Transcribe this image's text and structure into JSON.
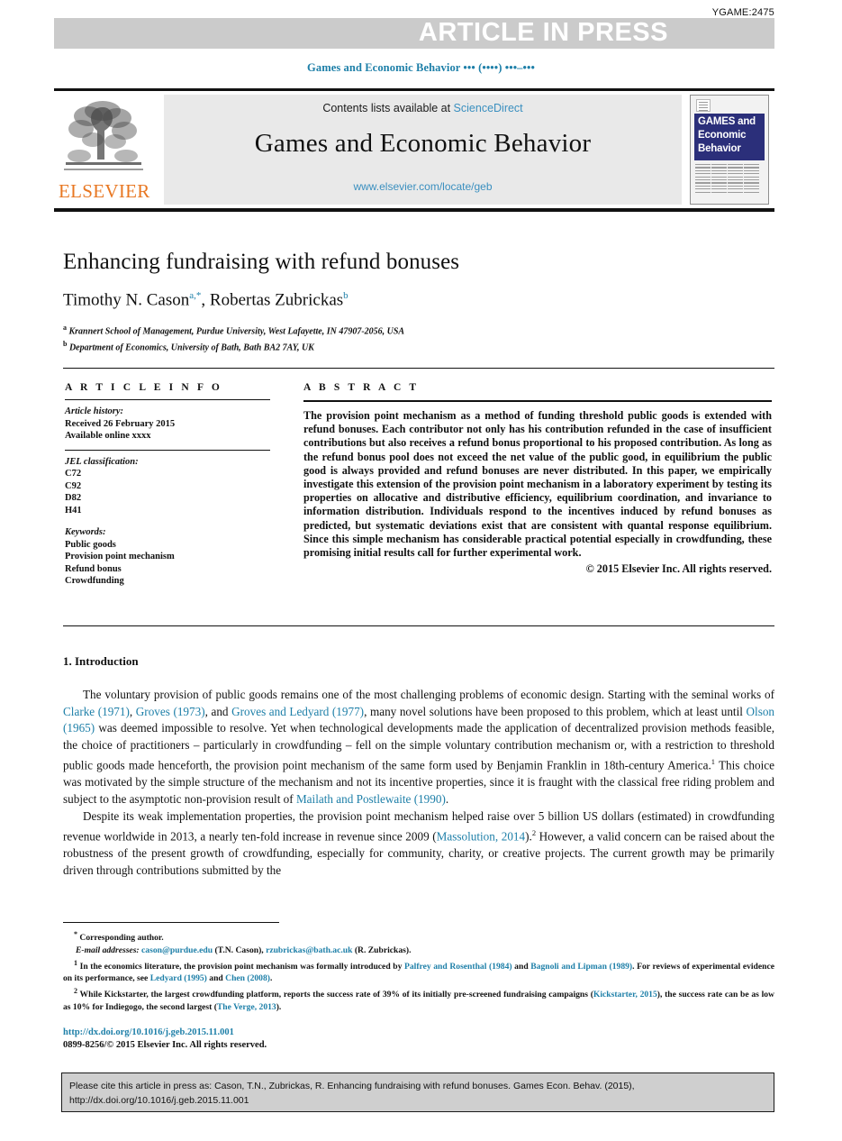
{
  "banner": {
    "press_label": "ARTICLE IN PRESS",
    "article_code": "YGAME:2475",
    "bar_color": "#cbcbcb"
  },
  "running_head": "Games and Economic Behavior ••• (••••) •••–•••",
  "masthead": {
    "publisher_name": "ELSEVIER",
    "contents_prefix": "Contents lists available at ",
    "contents_link": "ScienceDirect",
    "journal_title": "Games and Economic Behavior",
    "journal_url": "www.elsevier.com/locate/geb",
    "cover": {
      "line1": "GAMES and",
      "line2": "Economic",
      "line3": "Behavior",
      "cover_color": "#2b2f7a"
    }
  },
  "article": {
    "title": "Enhancing fundraising with refund bonuses",
    "authors": [
      {
        "name": "Timothy N. Cason",
        "marks": "a,*"
      },
      {
        "name": "Robertas Zubrickas",
        "marks": "b"
      }
    ],
    "affiliations": [
      {
        "mark": "a",
        "text": "Krannert School of Management, Purdue University, West Lafayette, IN 47907-2056, USA"
      },
      {
        "mark": "b",
        "text": "Department of Economics, University of Bath, Bath BA2 7AY, UK"
      }
    ]
  },
  "info": {
    "heading": "A R T I C L E    I N F O",
    "history_label": "Article history:",
    "history": [
      "Received 26 February 2015",
      "Available online xxxx"
    ],
    "jel_label": "JEL classification:",
    "jel_codes": [
      "C72",
      "C92",
      "D82",
      "H41"
    ],
    "keywords_label": "Keywords:",
    "keywords": [
      "Public goods",
      "Provision point mechanism",
      "Refund bonus",
      "Crowdfunding"
    ]
  },
  "abstract": {
    "heading": "A B S T R A C T",
    "text": "The provision point mechanism as a method of funding threshold public goods is extended with refund bonuses. Each contributor not only has his contribution refunded in the case of insufficient contributions but also receives a refund bonus proportional to his proposed contribution. As long as the refund bonus pool does not exceed the net value of the public good, in equilibrium the public good is always provided and refund bonuses are never distributed. In this paper, we empirically investigate this extension of the provision point mechanism in a laboratory experiment by testing its properties on allocative and distributive efficiency, equilibrium coordination, and invariance to information distribution. Individuals respond to the incentives induced by refund bonuses as predicted, but systematic deviations exist that are consistent with quantal response equilibrium. Since this simple mechanism has considerable practical potential especially in crowdfunding, these promising initial results call for further experimental work.",
    "copyright": "© 2015 Elsevier Inc. All rights reserved."
  },
  "section": {
    "number_title": "1. Introduction"
  },
  "body": {
    "p1_a": "The voluntary provision of public goods remains one of the most challenging problems of economic design. Starting with the seminal works of ",
    "p1_ref1": "Clarke (1971)",
    "p1_b": ", ",
    "p1_ref2": "Groves (1973)",
    "p1_c": ", and ",
    "p1_ref3": "Groves and Ledyard (1977)",
    "p1_d": ", many novel solutions have been proposed to this problem, which at least until ",
    "p1_ref4": "Olson (1965)",
    "p1_e": " was deemed impossible to resolve. Yet when technological developments made the application of decentralized provision methods feasible, the choice of practitioners – particularly in crowdfunding – fell on the simple voluntary contribution mechanism or, with a restriction to threshold public goods made henceforth, the provision point mechanism of the same form used by Benjamin Franklin in 18th-century America.",
    "p1_f": " This choice was motivated by the simple structure of the mechanism and not its incentive properties, since it is fraught with the classical free riding problem and subject to the asymptotic non-provision result of ",
    "p1_ref5": "Mailath and Postlewaite (1990)",
    "p1_g": ".",
    "p2_a": "Despite its weak implementation properties, the provision point mechanism helped raise over 5 billion US dollars (estimated) in crowdfunding revenue worldwide in 2013, a nearly ten-fold increase in revenue since 2009 (",
    "p2_ref1": "Massolution, 2014",
    "p2_b": ").",
    "p2_c": " However, a valid concern can be raised about the robustness of the present growth of crowdfunding, especially for community, charity, or creative projects. The current growth may be primarily driven through contributions submitted by the"
  },
  "footnotes": {
    "star_label": "*",
    "corresponding": "Corresponding author.",
    "email_label": "E-mail addresses:",
    "email1": "cason@purdue.edu",
    "email1_who": " (T.N. Cason), ",
    "email2": "rzubrickas@bath.ac.uk",
    "email2_who": " (R. Zubrickas).",
    "fn1_a": " In the economics literature, the provision point mechanism was formally introduced by ",
    "fn1_ref1": "Palfrey and Rosenthal (1984)",
    "fn1_b": " and ",
    "fn1_ref2": "Bagnoli and Lipman (1989)",
    "fn1_c": ". For reviews of experimental evidence on its performance, see ",
    "fn1_ref3": "Ledyard (1995)",
    "fn1_d": " and ",
    "fn1_ref4": "Chen (2008)",
    "fn1_e": ".",
    "fn2_a": " While Kickstarter, the largest crowdfunding platform, reports the success rate of 39% of its initially pre-screened fundraising campaigns (",
    "fn2_ref1": "Kickstarter, 2015",
    "fn2_b": "), the success rate can be as low as 10% for Indiegogo, the second largest (",
    "fn2_ref2": "The Verge, 2013",
    "fn2_c": ")."
  },
  "imprint": {
    "doi": "http://dx.doi.org/10.1016/j.geb.2015.11.001",
    "issn": "0899-8256/© 2015 Elsevier Inc. All rights reserved."
  },
  "cite_box": {
    "line1": "Please cite this article in press as: Cason, T.N., Zubrickas, R. Enhancing fundraising with refund bonuses. Games Econ. Behav. (2015),",
    "line2": "http://dx.doi.org/10.1016/j.geb.2015.11.001"
  },
  "colors": {
    "link": "#1d7fa8",
    "elsevier_orange": "#E87722",
    "cite_bg": "#cfcfcf"
  }
}
